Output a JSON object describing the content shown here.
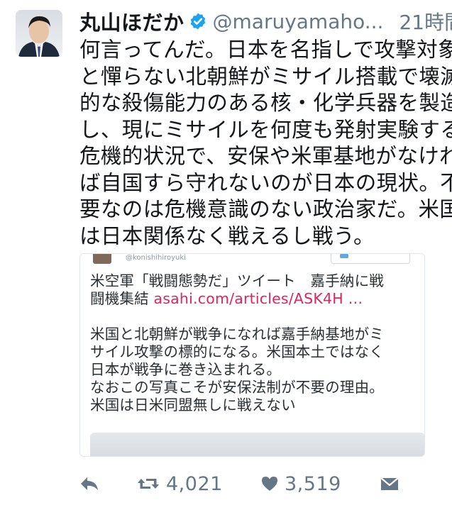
{
  "tweet": {
    "author_name": "丸山ほだか",
    "handle": "@maruyamaho...",
    "time": "21時間",
    "text_lines": [
      "何言ってんだ。日本を名指しで攻撃対象",
      "と憚らない北朝鮮がミサイル搭載で壊滅",
      "的な殺傷能力のある核・化学兵器を製造",
      "し、現にミサイルを何度も発射実験する",
      "危機的状況で、安保や米軍基地がなけれ",
      "ば自国すら守れないのが日本の現状。不",
      "要なのは危機意識のない政治家だ。米国",
      "は日本関係なく戦えるし戦う。"
    ]
  },
  "quoted": {
    "handle": "@konishihiroyuki",
    "line1": "米空軍「戦闘態勢だ」ツイート　嘉手納に戦",
    "line2_text": "闘機集結 ",
    "line2_link": "asahi.com/articles/ASK4H …",
    "body_lines": [
      "米国と北朝鮮が戦争になれば嘉手納基地がミ",
      "サイル攻撃の標的になる。米国本土ではなく",
      "日本が戦争に巻き込まれる。",
      "なおこの写真こそが安保法制が不要の理由。",
      "米国は日米同盟無しに戦えない"
    ]
  },
  "actions": {
    "retweets": "4,021",
    "likes": "3,519"
  },
  "colors": {
    "verified": "#1da1f2",
    "link": "#e0245e",
    "muted": "#657786"
  }
}
